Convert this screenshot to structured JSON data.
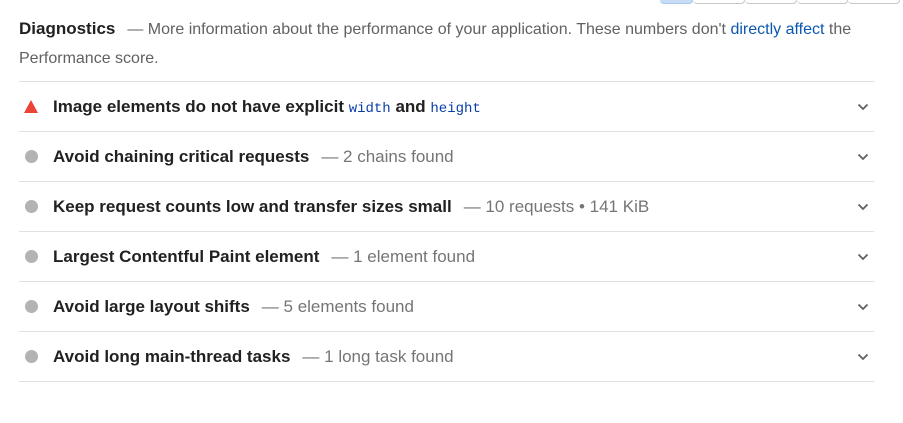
{
  "section": {
    "title": "Diagnostics",
    "desc_pre": "— More information about the performance of your application. These numbers don't ",
    "desc_link": "directly affect",
    "desc_post": " the Performance score."
  },
  "audits": [
    {
      "icon": "warning-triangle-icon",
      "title_pre": "Image elements do not have explicit ",
      "code1": "width",
      "title_mid": " and ",
      "code2": "height",
      "display": ""
    },
    {
      "icon": "gray-circle-icon",
      "title": "Avoid chaining critical requests",
      "display": "— 2 chains found"
    },
    {
      "icon": "gray-circle-icon",
      "title": "Keep request counts low and transfer sizes small",
      "display": "— 10 requests • 141 KiB"
    },
    {
      "icon": "gray-circle-icon",
      "title": "Largest Contentful Paint element",
      "display": "— 1 element found"
    },
    {
      "icon": "gray-circle-icon",
      "title": "Avoid large layout shifts",
      "display": "— 5 elements found"
    },
    {
      "icon": "gray-circle-icon",
      "title": "Avoid long main-thread tasks",
      "display": "— 1 long task found"
    }
  ],
  "colors": {
    "warning": "#eb4436",
    "neutral": "#b3b3b3",
    "link": "#0b57b0",
    "code": "#0b3fa8"
  }
}
